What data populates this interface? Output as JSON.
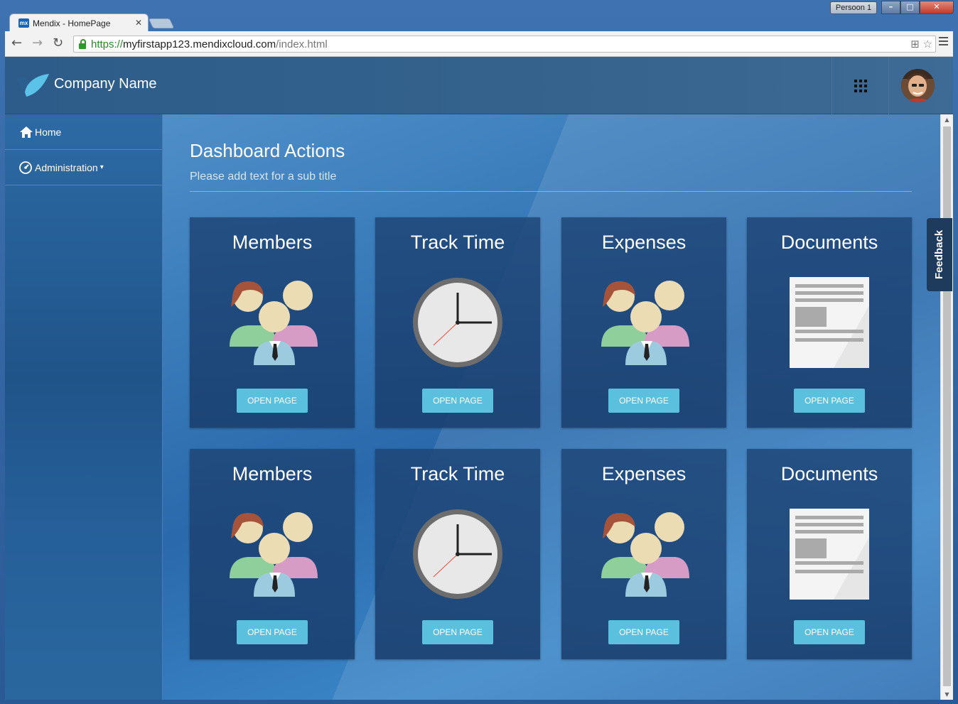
{
  "browser": {
    "profile_label": "Persoon 1",
    "tab_title": "Mendix - HomePage",
    "favicon_text": "mx",
    "url_scheme": "https://",
    "url_host": "myfirstapp123.mendixcloud.com",
    "url_path": "/index.html"
  },
  "header": {
    "company_name": "Company Name"
  },
  "sidebar": {
    "items": [
      {
        "label": "Home",
        "icon": "home-icon"
      },
      {
        "label": "Administration",
        "icon": "dashboard-icon",
        "has_dropdown": true
      }
    ]
  },
  "dashboard": {
    "title": "Dashboard Actions",
    "subtitle": "Please add text for a sub title"
  },
  "cards": [
    {
      "title": "Members",
      "icon": "members-icon",
      "button": "OPEN PAGE"
    },
    {
      "title": "Track Time",
      "icon": "clock-icon",
      "button": "OPEN PAGE"
    },
    {
      "title": "Expenses",
      "icon": "members-icon",
      "button": "OPEN PAGE"
    },
    {
      "title": "Documents",
      "icon": "document-icon",
      "button": "OPEN PAGE"
    },
    {
      "title": "Members",
      "icon": "members-icon",
      "button": "OPEN PAGE"
    },
    {
      "title": "Track Time",
      "icon": "clock-icon",
      "button": "OPEN PAGE"
    },
    {
      "title": "Expenses",
      "icon": "members-icon",
      "button": "OPEN PAGE"
    },
    {
      "title": "Documents",
      "icon": "document-icon",
      "button": "OPEN PAGE"
    }
  ],
  "feedback": {
    "label": "Feedback"
  },
  "colors": {
    "button": "#5bc0de",
    "header": "#35638d",
    "feedback_tab": "#1e3a5c"
  }
}
